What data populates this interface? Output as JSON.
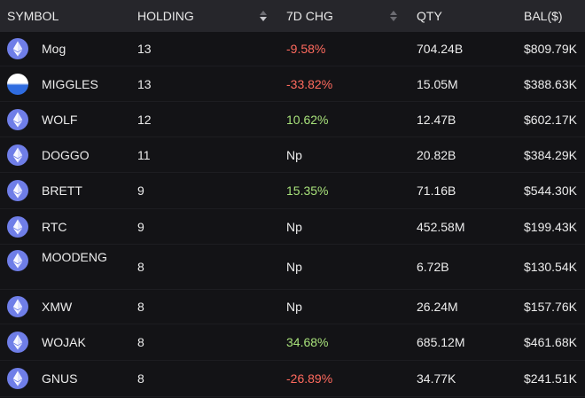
{
  "header": {
    "symbol": "SYMBOL",
    "holding": "HOLDING",
    "chg": "7D CHG",
    "qty": "QTY",
    "bal": "BAL($)"
  },
  "colors": {
    "negative": "#ff6a5e",
    "positive": "#a7e07a",
    "icon": "#6f7ee8"
  },
  "rows": [
    {
      "symbol": "Mog",
      "holding": "13",
      "chg": "-9.58%",
      "qty": "704.24B",
      "bal": "$809.79K",
      "icon": "ethereum-icon"
    },
    {
      "symbol": "MIGGLES",
      "holding": "13",
      "chg": "-33.82%",
      "qty": "15.05M",
      "bal": "$388.63K",
      "icon": "half-circle-icon"
    },
    {
      "symbol": "WOLF",
      "holding": "12",
      "chg": "10.62%",
      "qty": "12.47B",
      "bal": "$602.17K",
      "icon": "ethereum-icon"
    },
    {
      "symbol": "DOGGO",
      "holding": "11",
      "chg": "Np",
      "qty": "20.82B",
      "bal": "$384.29K",
      "icon": "ethereum-icon"
    },
    {
      "symbol": "BRETT",
      "holding": "9",
      "chg": "15.35%",
      "qty": "71.16B",
      "bal": "$544.30K",
      "icon": "ethereum-icon"
    },
    {
      "symbol": "RTC",
      "holding": "9",
      "chg": "Np",
      "qty": "452.58M",
      "bal": "$199.43K",
      "icon": "ethereum-icon"
    },
    {
      "symbol": "MOODENG",
      "holding": "8",
      "chg": "Np",
      "qty": "6.72B",
      "bal": "$130.54K",
      "icon": "ethereum-icon"
    },
    {
      "symbol": "XMW",
      "holding": "8",
      "chg": "Np",
      "qty": "26.24M",
      "bal": "$157.76K",
      "icon": "ethereum-icon"
    },
    {
      "symbol": "WOJAK",
      "holding": "8",
      "chg": "34.68%",
      "qty": "685.12M",
      "bal": "$461.68K",
      "icon": "ethereum-icon"
    },
    {
      "symbol": "GNUS",
      "holding": "8",
      "chg": "-26.89%",
      "qty": "34.77K",
      "bal": "$241.51K",
      "icon": "ethereum-icon"
    }
  ]
}
